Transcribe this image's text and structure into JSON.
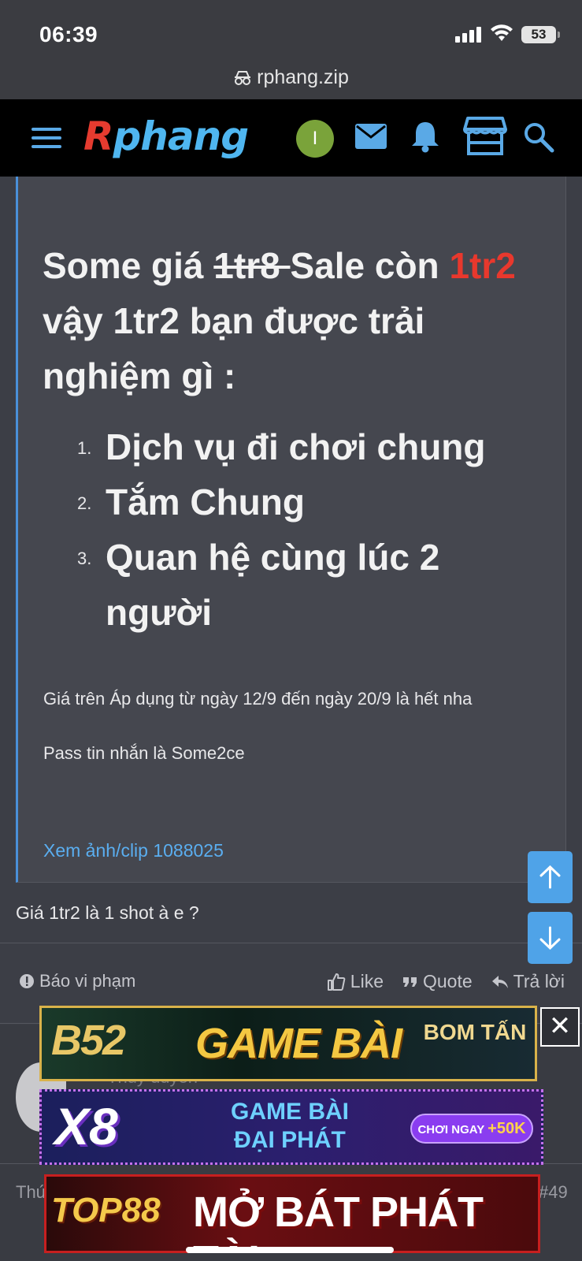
{
  "status_bar": {
    "time": "06:39",
    "battery": "53"
  },
  "browser": {
    "url": "rphang.zip"
  },
  "header": {
    "logo_first": "R",
    "logo_rest": "phang",
    "avatar_initial": "I"
  },
  "post": {
    "headline_part1": "Some giá ",
    "headline_struck": "1tr8 ",
    "headline_part2": "Sale còn ",
    "headline_red": "1tr2",
    "headline_part3": " vậy 1tr2 bạn được trải nghiệm gì :",
    "list": [
      {
        "num": "1.",
        "text": "Dịch vụ đi chơi chung"
      },
      {
        "num": "2.",
        "text": "Tắm Chung"
      },
      {
        "num": "3.",
        "text": "Quan hệ cùng lúc 2 người"
      }
    ],
    "price_note": "Giá trên Áp dụng từ ngày 12/9 đến ngày 20/9 là hết nha",
    "pass_note": "Pass tin nhắn là Some2ce",
    "media_link": "Xem ảnh/clip 1088025"
  },
  "reply": {
    "text": "Giá 1tr2 là 1 shot à e ?"
  },
  "actions": {
    "report": "Báo vi phạm",
    "like": "Like",
    "quote": "Quote",
    "reply": "Trả lời"
  },
  "next_post": {
    "peek_text": "Thủy đuyển",
    "left_text": "Thứ",
    "post_number": "#49"
  },
  "ads": {
    "b52": {
      "logo": "B52",
      "main": "GAME BÀI",
      "sub": "BOM TẤN"
    },
    "x8": {
      "logo": "X8",
      "line1": "GAME BÀI",
      "line2": "ĐẠI PHÁT",
      "cta_text": "CHƠI NGAY",
      "cta_bonus": "+50K"
    },
    "top88": {
      "logo": "TOP88",
      "main": "MỞ BÁT PHÁT TÀI"
    },
    "close": "✕"
  },
  "colors": {
    "accent_blue": "#4fa3e8",
    "highlight_red": "#e8382d",
    "avatar_green": "#7aa33a"
  },
  "icons": [
    "menu-icon",
    "mail-icon",
    "bell-icon",
    "store-icon",
    "search-icon",
    "arrow-up-icon",
    "arrow-down-icon",
    "alert-icon",
    "like-icon",
    "quote-icon",
    "reply-icon",
    "lock-icon"
  ]
}
